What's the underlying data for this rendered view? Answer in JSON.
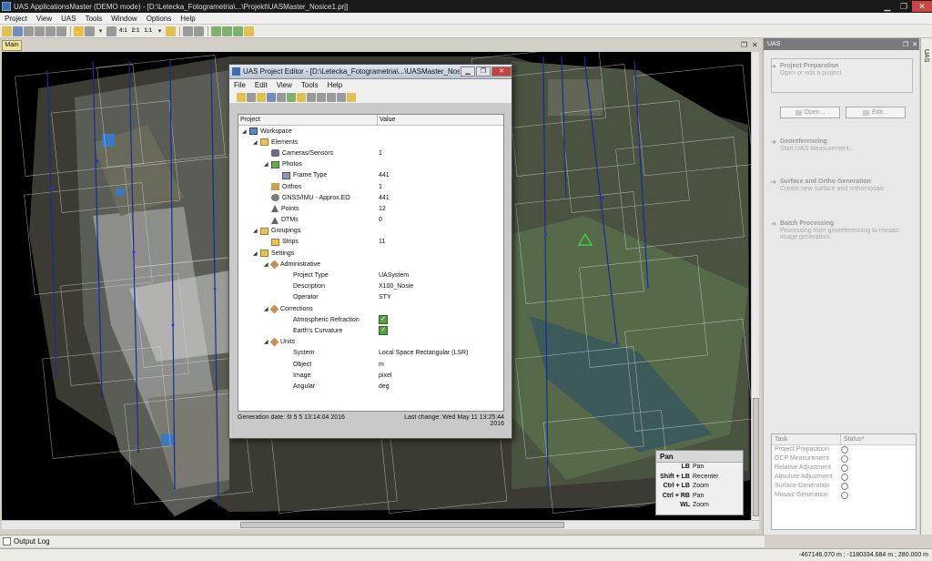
{
  "window": {
    "title": "UAS ApplicationsMaster (DEMO mode) - [D:\\Letecka_Fotogrametria\\...\\Projekt\\UASMaster_Nosice1.prj]"
  },
  "menubar": [
    "Project",
    "View",
    "UAS",
    "Tools",
    "Window",
    "Options",
    "Help"
  ],
  "toolbar": {
    "zoom_labels": [
      "4:1",
      "2:1",
      "1:1"
    ]
  },
  "main_tab": {
    "label": "Main"
  },
  "dialog": {
    "title": "UAS Project Editor - [D:\\Letecka_Fotogrametria\\...\\UASMaster_Nosice...",
    "menu": [
      "File",
      "Edit",
      "View",
      "Tools",
      "Help"
    ],
    "columns": {
      "project": "Project",
      "value": "Value"
    },
    "rows": [
      {
        "label": "Workspace",
        "value": "",
        "indent": 0,
        "icon": "workspace-icon",
        "expander": "◢"
      },
      {
        "label": "Elements",
        "value": "",
        "indent": 1,
        "icon": "folder-icon",
        "expander": "◢"
      },
      {
        "label": "Cameras/Sensors",
        "value": "1",
        "indent": 2,
        "icon": "camera-icon",
        "expander": ""
      },
      {
        "label": "Photos",
        "value": "",
        "indent": 2,
        "icon": "photo-icon",
        "expander": "◢"
      },
      {
        "label": "Frame Type",
        "value": "441",
        "indent": 3,
        "icon": "frame-icon",
        "expander": ""
      },
      {
        "label": "Orthos",
        "value": "1",
        "indent": 2,
        "icon": "ortho-icon",
        "expander": ""
      },
      {
        "label": "GNSS/IMU - Approx.EO",
        "value": "441",
        "indent": 2,
        "icon": "gnss-icon",
        "expander": ""
      },
      {
        "label": "Points",
        "value": "12",
        "indent": 2,
        "icon": "points-icon",
        "expander": ""
      },
      {
        "label": "DTMs",
        "value": "0",
        "indent": 2,
        "icon": "dtm-icon",
        "expander": ""
      },
      {
        "label": "Groupings",
        "value": "",
        "indent": 1,
        "icon": "folder-icon",
        "expander": "◢"
      },
      {
        "label": "Strips",
        "value": "11",
        "indent": 2,
        "icon": "folder-icon",
        "expander": ""
      },
      {
        "label": "Settings",
        "value": "",
        "indent": 1,
        "icon": "folder-icon",
        "expander": "◢"
      },
      {
        "label": "Administrative",
        "value": "",
        "indent": 2,
        "icon": "tools-icon",
        "expander": "◢"
      },
      {
        "label": "Project Type",
        "value": "UASystem",
        "indent": 3,
        "icon": "",
        "expander": ""
      },
      {
        "label": "Description",
        "value": "X100_Nosie",
        "indent": 3,
        "icon": "",
        "expander": ""
      },
      {
        "label": "Operator",
        "value": "STY",
        "indent": 3,
        "icon": "",
        "expander": ""
      },
      {
        "label": "Corrections",
        "value": "",
        "indent": 2,
        "icon": "tools-icon",
        "expander": "◢"
      },
      {
        "label": "Atmospheric Refraction",
        "value": "",
        "indent": 3,
        "icon": "",
        "expander": "",
        "check": true
      },
      {
        "label": "Earth's Curvature",
        "value": "",
        "indent": 3,
        "icon": "",
        "expander": "",
        "check": true
      },
      {
        "label": "Units",
        "value": "",
        "indent": 2,
        "icon": "tools-icon",
        "expander": "◢"
      },
      {
        "label": "System",
        "value": "Local Space Rectangular (LSR)",
        "indent": 3,
        "icon": "",
        "expander": ""
      },
      {
        "label": "Object",
        "value": "m",
        "indent": 3,
        "icon": "",
        "expander": ""
      },
      {
        "label": "Image",
        "value": "pixel",
        "indent": 3,
        "icon": "",
        "expander": ""
      },
      {
        "label": "Angular",
        "value": "deg",
        "indent": 3,
        "icon": "",
        "expander": ""
      }
    ],
    "generation_date": "Generation date:  št 5 5 13:14:04 2016",
    "last_change": "Last change:  Wed May 11 13:25:44 2016"
  },
  "pan_legend": {
    "title": "Pan",
    "rows": [
      {
        "keys": "LB",
        "action": "Pan"
      },
      {
        "keys": "Shift + LB",
        "action": "Recenter"
      },
      {
        "keys": "Ctrl + LB",
        "action": "Zoom"
      },
      {
        "keys": "Ctrl + RB",
        "action": "Pan"
      },
      {
        "keys": "WL",
        "action": "Zoom"
      }
    ]
  },
  "uas_panel": {
    "header": "UAS",
    "side_tab": "UAS",
    "sections": [
      {
        "title": "Project Preparation",
        "subtitle": "Open or edit a project."
      },
      {
        "title": "Georeferencing",
        "subtitle": "Start UAS Measurement..."
      },
      {
        "title": "Surface and Ortho Generation",
        "subtitle": "Create new surface and orthomosaic"
      },
      {
        "title": "Batch Processing",
        "subtitle": "Processing from georeferencing to mosaic image generation."
      }
    ],
    "open_button": "Open...",
    "edit_button": "Edit...",
    "task_header": {
      "task": "Task",
      "status": "Status*"
    },
    "tasks": [
      "Project Preparation",
      "GCP Measurement",
      "Relative Adjustment",
      "Absolute Adjustment",
      "Surface Generation",
      "Mosaic Generation"
    ]
  },
  "output_log": {
    "label": "Output Log"
  },
  "status": {
    "coords": "-467146.070 m ; -1180334.684 m ; 280.000 m"
  }
}
